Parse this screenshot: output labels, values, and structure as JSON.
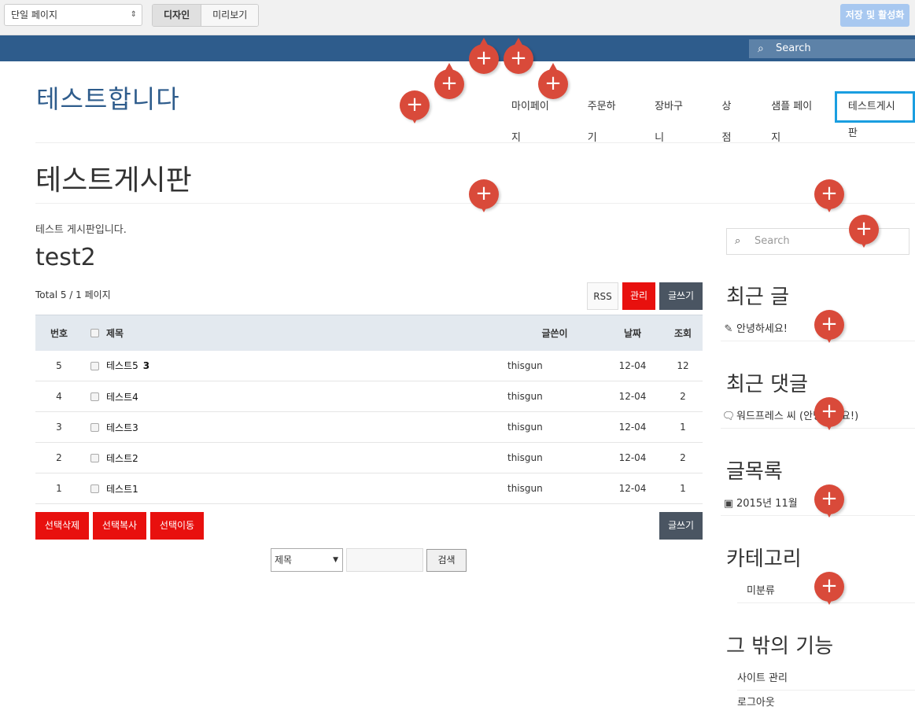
{
  "editor": {
    "page_select": "단일 페이지",
    "mode_design": "디자인",
    "mode_preview": "미리보기",
    "publish": "저장 및 활성화"
  },
  "topbar": {
    "search_placeholder": "Search"
  },
  "site": {
    "title": "테스트합니다",
    "nav": [
      "마이페이지",
      "주문하기",
      "장바구니",
      "상점",
      "샘플 페이지",
      "테스트게시판"
    ]
  },
  "page": {
    "heading": "테스트게시판",
    "description": "테스트 게시판입니다.",
    "post_title": "test2",
    "total_info": "Total 5 / 1 페이지"
  },
  "board": {
    "buttons": {
      "rss": "RSS",
      "admin": "관리",
      "write": "글쓰기"
    },
    "columns": {
      "num": "번호",
      "title": "제목",
      "writer": "글쓴이",
      "date": "날짜",
      "views": "조회"
    },
    "rows": [
      {
        "num": "5",
        "title": "테스트5",
        "comments": "3",
        "writer": "thisgun",
        "date": "12-04",
        "views": "12"
      },
      {
        "num": "4",
        "title": "테스트4",
        "comments": "",
        "writer": "thisgun",
        "date": "12-04",
        "views": "2"
      },
      {
        "num": "3",
        "title": "테스트3",
        "comments": "",
        "writer": "thisgun",
        "date": "12-04",
        "views": "1"
      },
      {
        "num": "2",
        "title": "테스트2",
        "comments": "",
        "writer": "thisgun",
        "date": "12-04",
        "views": "2"
      },
      {
        "num": "1",
        "title": "테스트1",
        "comments": "",
        "writer": "thisgun",
        "date": "12-04",
        "views": "1"
      }
    ],
    "bulk": {
      "delete": "선택삭제",
      "copy": "선택복사",
      "move": "선택이동",
      "write": "글쓰기"
    },
    "search": {
      "field_select": "제목",
      "button": "검색"
    }
  },
  "sidebar": {
    "search_placeholder": "Search",
    "recent_posts_title": "최근 글",
    "recent_posts": [
      "안녕하세요!"
    ],
    "recent_comments_title": "최근 댓글",
    "recent_comments": [
      "워드프레스 씨 (안녕하세요!)"
    ],
    "archives_title": "글목록",
    "archives": [
      "2015년 11월"
    ],
    "categories_title": "카테고리",
    "categories": [
      "미분류"
    ],
    "meta_title": "그 밖의 기능",
    "meta": [
      "사이트 관리",
      "로그아웃"
    ]
  },
  "icons": {
    "search": "search-icon",
    "pencil": "pencil-icon",
    "comment": "comment-icon",
    "archive": "archive-icon",
    "add": "add-icon"
  },
  "colors": {
    "brand_blue": "#2e5c8c",
    "danger_red": "#e8100e",
    "dark_button": "#4a5562",
    "marker_red": "#d94a3a",
    "active_nav_border": "#1a9ee0"
  }
}
